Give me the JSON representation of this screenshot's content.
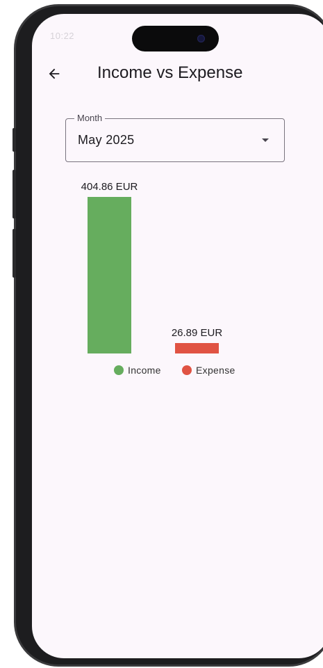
{
  "status_bar": {
    "time": "10:22",
    "battery": ""
  },
  "app_bar": {
    "title": "Income vs Expense",
    "back_icon": "arrow-left-icon"
  },
  "month_select": {
    "label": "Month",
    "value": "May 2025",
    "icon": "dropdown-arrow-icon"
  },
  "chart_data": {
    "type": "bar",
    "categories": [
      "Income",
      "Expense"
    ],
    "values": [
      404.86,
      26.89
    ],
    "data_labels": [
      "404.86 EUR",
      "26.89 EUR"
    ],
    "colors": [
      "#66ad5e",
      "#e05343"
    ],
    "unit": "EUR",
    "legend": {
      "items": [
        "Income",
        "Expense"
      ],
      "position": "bottom"
    },
    "title": "",
    "xlabel": "",
    "ylabel": "",
    "grid": false
  }
}
